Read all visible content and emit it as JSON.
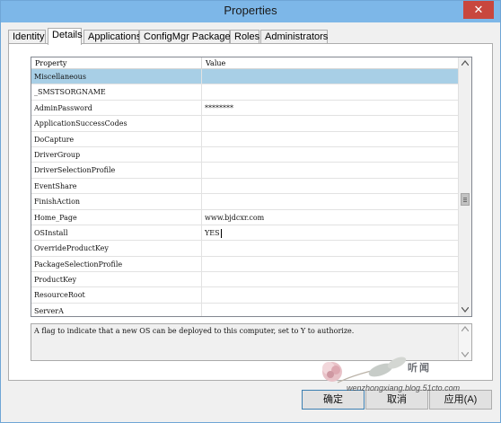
{
  "window": {
    "title": "Properties",
    "close_glyph": "✕"
  },
  "tabs": [
    {
      "label": "Identity"
    },
    {
      "label": "Details"
    },
    {
      "label": "Applications"
    },
    {
      "label": "ConfigMgr Packages"
    },
    {
      "label": "Roles"
    },
    {
      "label": "Administrators"
    }
  ],
  "active_tab": "Details",
  "grid": {
    "header": {
      "property": "Property",
      "value": "Value"
    },
    "rows": [
      {
        "property": "Miscellaneous",
        "value": ""
      },
      {
        "property": "_SMSTSORGNAME",
        "value": ""
      },
      {
        "property": "AdminPassword",
        "value": "********"
      },
      {
        "property": "ApplicationSuccessCodes",
        "value": ""
      },
      {
        "property": "DoCapture",
        "value": ""
      },
      {
        "property": "DriverGroup",
        "value": ""
      },
      {
        "property": "DriverSelectionProfile",
        "value": ""
      },
      {
        "property": "EventShare",
        "value": ""
      },
      {
        "property": "FinishAction",
        "value": ""
      },
      {
        "property": "Home_Page",
        "value": "www.bjdcxr.com"
      },
      {
        "property": "OSInstall",
        "value": "YES"
      },
      {
        "property": "OverrideProductKey",
        "value": ""
      },
      {
        "property": "PackageSelectionProfile",
        "value": ""
      },
      {
        "property": "ProductKey",
        "value": ""
      },
      {
        "property": "ResourceRoot",
        "value": ""
      },
      {
        "property": "ServerA",
        "value": ""
      }
    ],
    "selected_row": "Miscellaneous",
    "editing_row": "OSInstall"
  },
  "description": {
    "text": "A flag to indicate that a new OS can be deployed to this computer, set to Y to authorize."
  },
  "buttons": {
    "ok": "确定",
    "cancel": "取消",
    "apply": "应用(A)"
  },
  "watermark": {
    "chinese_text": "听闻",
    "url": "wenzhongxiang.blog.51cto.com"
  },
  "icons": {
    "scroll_up": "chevron-up-icon",
    "scroll_down": "chevron-down-icon",
    "close": "close-icon"
  },
  "colors": {
    "titlebar": "#7db7e8",
    "close_button": "#c8473e",
    "selected_row": "#a8cfe6",
    "default_button_border": "#3c7fb1"
  }
}
